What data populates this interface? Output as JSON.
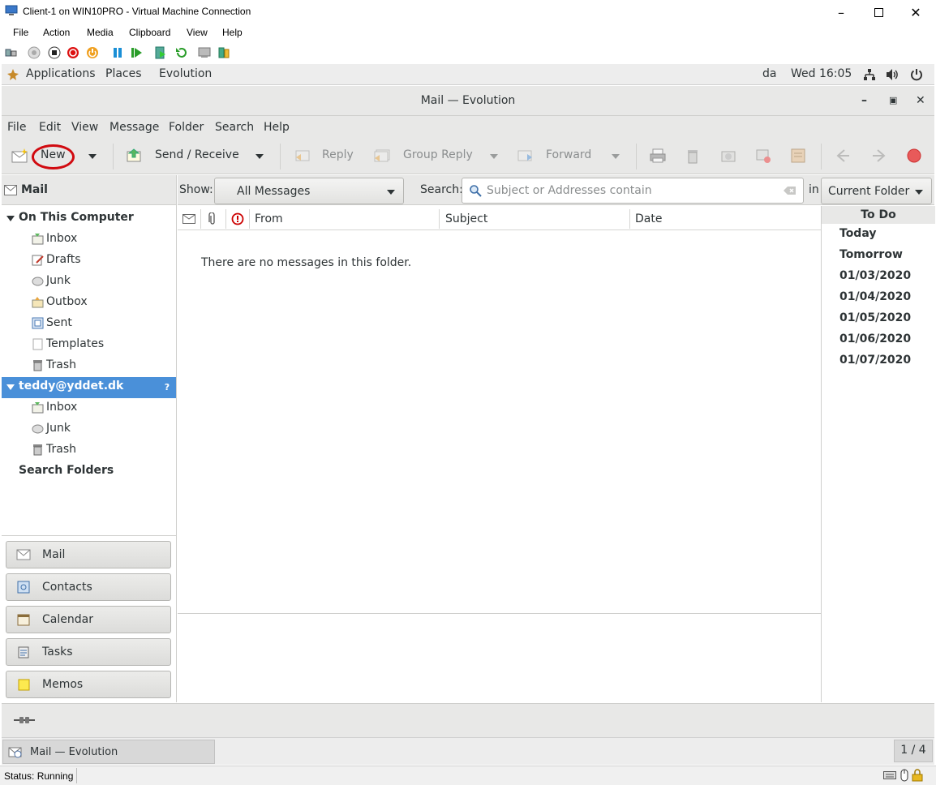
{
  "host": {
    "title": "Client-1 on WIN10PRO - Virtual Machine Connection",
    "menu": [
      "File",
      "Action",
      "Media",
      "Clipboard",
      "View",
      "Help"
    ],
    "status": "Status: Running"
  },
  "gnome": {
    "applications": "Applications",
    "places": "Places",
    "evolution": "Evolution",
    "keyboard_layout": "da",
    "clock": "Wed 16:05"
  },
  "evo": {
    "title": "Mail — Evolution",
    "menu": [
      "File",
      "Edit",
      "View",
      "Message",
      "Folder",
      "Search",
      "Help"
    ],
    "toolbar": {
      "new": "New",
      "send_receive": "Send / Receive",
      "reply": "Reply",
      "group_reply": "Group Reply",
      "forward": "Forward"
    }
  },
  "sidebar": {
    "header": "Mail",
    "local_account": "On This Computer",
    "local_folders": [
      "Inbox",
      "Drafts",
      "Junk",
      "Outbox",
      "Sent",
      "Templates",
      "Trash"
    ],
    "remote_account": "teddy@yddet.dk",
    "remote_folders": [
      "Inbox",
      "Junk",
      "Trash"
    ],
    "search_folders": "Search Folders"
  },
  "switcher": [
    "Mail",
    "Contacts",
    "Calendar",
    "Tasks",
    "Memos"
  ],
  "filter": {
    "show_label": "Show:",
    "show_value": "All Messages",
    "search_label": "Search:",
    "search_placeholder": "Subject or Addresses contain",
    "in_label": "in",
    "scope_value": "Current Folder"
  },
  "columns": {
    "from": "From",
    "subject": "Subject",
    "date": "Date"
  },
  "empty_message": "There are no messages in this folder.",
  "todo": {
    "header": "To Do",
    "items": [
      "Today",
      "Tomorrow",
      "01/03/2020",
      "01/04/2020",
      "01/05/2020",
      "01/06/2020",
      "01/07/2020"
    ]
  },
  "taskbar": {
    "item": "Mail — Evolution",
    "pager": "1 / 4"
  },
  "colors": {
    "selection": "#4a90d9",
    "highlight_ring": "#d10a10"
  }
}
